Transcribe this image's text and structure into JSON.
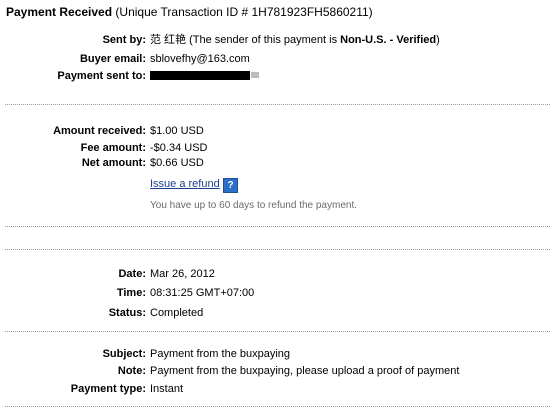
{
  "header": {
    "title": "Payment Received",
    "transaction": "(Unique Transaction ID # 1H781923FH5860211)"
  },
  "sender": {
    "sent_by_label": "Sent by:",
    "sent_by_name": "范 红艳",
    "sent_by_note_prefix": "(The sender of this payment is ",
    "sent_by_status": "Non-U.S. - Verified",
    "sent_by_note_suffix": ")",
    "buyer_email_label": "Buyer email:",
    "buyer_email": "sblovefhy@163.com",
    "payment_sent_to_label": "Payment sent to:"
  },
  "amounts": {
    "received_label": "Amount received:",
    "received": "$1.00 USD",
    "fee_label": "Fee amount:",
    "fee": "-$0.34 USD",
    "net_label": "Net amount:",
    "net": "$0.66 USD",
    "refund_link": "Issue a refund",
    "help_icon_text": "?",
    "refund_note": "You have up to 60 days to refund the payment."
  },
  "details": {
    "date_label": "Date:",
    "date": "Mar 26, 2012",
    "time_label": "Time:",
    "time": "08:31:25 GMT+07:00",
    "status_label": "Status:",
    "status": "Completed"
  },
  "message": {
    "subject_label": "Subject:",
    "subject": "Payment from the buxpaying",
    "note_label": "Note:",
    "note": "Payment from the buxpaying, please upload a proof of payment",
    "type_label": "Payment type:",
    "type": "Instant"
  },
  "colors": {
    "link": "#1c3f8f",
    "help_icon": "#2a6fc8",
    "muted_text": "#6b6b6b",
    "divider": "#9a9a9a"
  },
  "icons": {
    "help": "help-icon"
  }
}
